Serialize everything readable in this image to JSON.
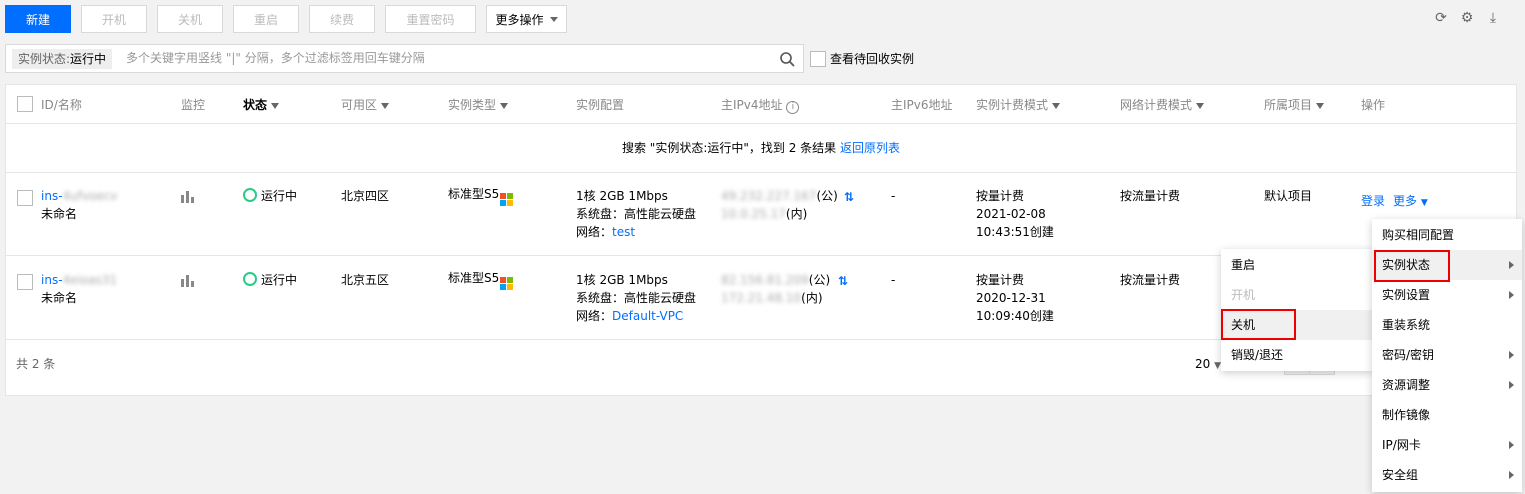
{
  "toolbar": {
    "new_label": "新建",
    "start_label": "开机",
    "stop_label": "关机",
    "restart_label": "重启",
    "renew_label": "续费",
    "reset_pwd_label": "重置密码",
    "more_label": "更多操作"
  },
  "search": {
    "tag_key": "实例状态:",
    "tag_value": "运行中",
    "placeholder": "多个关键字用竖线 \"|\" 分隔，多个过滤标签用回车键分隔"
  },
  "recycle_label": "查看待回收实例",
  "table": {
    "headers": {
      "id": "ID/名称",
      "monitor": "监控",
      "status": "状态",
      "zone": "可用区",
      "type": "实例类型",
      "config": "实例配置",
      "ipv4": "主IPv4地址",
      "ipv6": "主IPv6地址",
      "billing": "实例计费模式",
      "net_billing": "网络计费模式",
      "project": "所属项目",
      "ops": "操作"
    },
    "search_result": "搜索 \"实例状态:运行中\"，找到 2 条结果",
    "back_link": "返回原列表",
    "rows": [
      {
        "id": "ins-4ufvoecv",
        "name": "未命名",
        "status": "运行中",
        "zone": "北京四区",
        "type": "标准型S5",
        "config_line1": "1核 2GB 1Mbps",
        "config_line2": "系统盘：高性能云硬盘",
        "network_label": "网络：",
        "network_value": "test",
        "public_ip": "49.232.227.167",
        "public_suffix": "(公)",
        "private_ip": "10.0.25.17",
        "private_suffix": "(内)",
        "ipv6": "-",
        "billing_mode": "按量计费",
        "billing_date": "2021-02-08",
        "billing_time": "10:43:51创建",
        "net_billing": "按流量计费",
        "project": "默认项目",
        "login_label": "登录",
        "more_label": "更多"
      },
      {
        "id": "ins-4eioas31",
        "name": "未命名",
        "status": "运行中",
        "zone": "北京五区",
        "type": "标准型S5",
        "config_line1": "1核 2GB 1Mbps",
        "config_line2": "系统盘：高性能云硬盘",
        "network_label": "网络：",
        "network_value": "Default-VPC",
        "public_ip": "82.156.81.209",
        "public_suffix": "(公)",
        "private_ip": "172.21.48.10",
        "private_suffix": "(内)",
        "ipv6": "-",
        "billing_mode": "按量计费",
        "billing_date": "2020-12-31",
        "billing_time": "10:09:40创建",
        "net_billing": "按流量计费"
      }
    ]
  },
  "footer": {
    "total": "共 2 条",
    "page_size": "20"
  },
  "more_menu": [
    {
      "label": "购买相同配置"
    },
    {
      "label": "实例状态"
    },
    {
      "label": "实例设置"
    },
    {
      "label": "重装系统"
    },
    {
      "label": "密码/密钥"
    },
    {
      "label": "资源调整"
    },
    {
      "label": "制作镜像"
    },
    {
      "label": "IP/网卡"
    },
    {
      "label": "安全组"
    }
  ],
  "status_submenu": [
    {
      "label": "重启"
    },
    {
      "label": "开机"
    },
    {
      "label": "关机"
    },
    {
      "label": "销毁/退还"
    }
  ],
  "colors": {
    "primary": "#006eff",
    "running": "#29cc85",
    "highlight": "#e00000"
  }
}
